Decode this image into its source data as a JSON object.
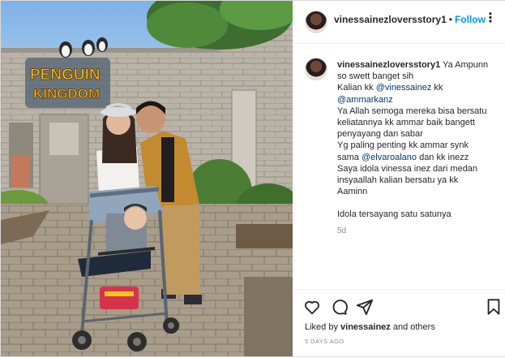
{
  "post": {
    "username": "vinessainezloversstory1",
    "separator": "•",
    "follow_label": "Follow",
    "more_label": "⋮"
  },
  "photo": {
    "sign_line1": "PENGUIN",
    "sign_line2": "KINGDOM"
  },
  "comment": {
    "username": "vinessainezloversstory1",
    "lines": [
      {
        "text": " Ya Ampunn",
        "inline": true
      },
      {
        "text": "so swett banget sih"
      },
      {
        "pre": "Kalian kk ",
        "mention": "@vinessainez",
        "post": " kk"
      },
      {
        "mention": "@ammarkanz"
      },
      {
        "text": "Ya Allah semoga mereka bisa bersatu"
      },
      {
        "text": "keliatannya kk ammar baik bangett"
      },
      {
        "text": "penyayang dan sabar"
      },
      {
        "text": "Yg paling penting kk ammar synk"
      },
      {
        "pre": "sama ",
        "mention": "@elvaroalano",
        "post": " dan kk inezz"
      },
      {
        "text": "Saya idola vinessa inez dari medan"
      },
      {
        "text": "insyaallah kalian bersatu ya kk"
      },
      {
        "text": "Aaminn"
      },
      {
        "text": ""
      },
      {
        "text": "Idola tersayang satu satunya"
      }
    ],
    "time": "5d"
  },
  "actions": {
    "liked_by_prefix": "Liked by ",
    "liked_by_user": "vinessainez",
    "liked_by_suffix": " and others",
    "time_ago": "5 DAYS AGO"
  },
  "icons": {
    "like": "heart-icon",
    "comment": "comment-icon",
    "share": "share-icon",
    "save": "bookmark-icon",
    "more": "more-options-icon"
  },
  "colors": {
    "follow": "#0095f6",
    "mention": "#00376b",
    "muted": "#8e8e8e",
    "text": "#262626"
  }
}
